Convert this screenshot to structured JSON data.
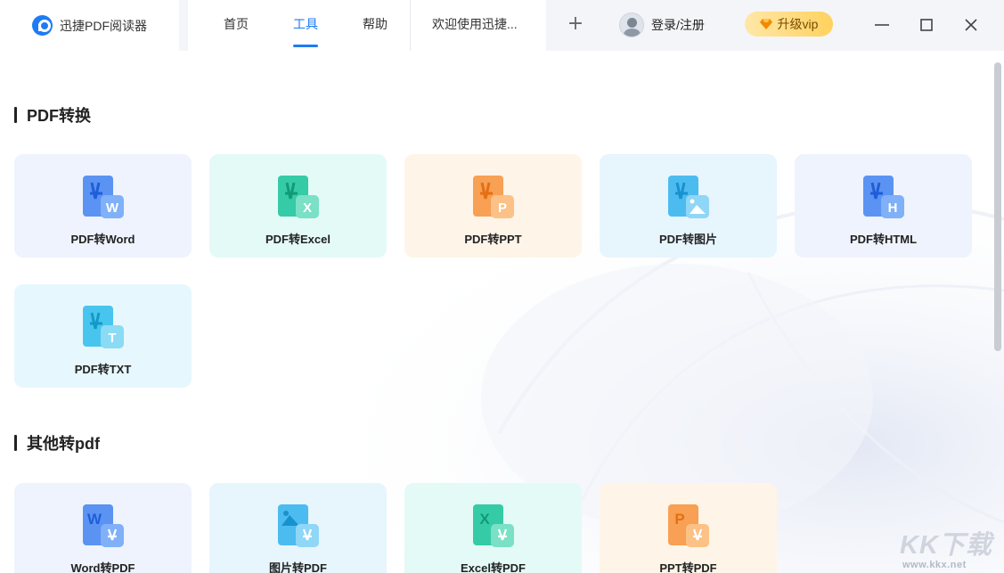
{
  "app": {
    "name": "迅捷PDF阅读器"
  },
  "tabs": [
    {
      "label": "首页",
      "active": false
    },
    {
      "label": "工具",
      "active": true
    },
    {
      "label": "帮助",
      "active": false
    },
    {
      "label": "欢迎使用迅捷...",
      "active": false
    }
  ],
  "new_tab_icon": "plus-icon",
  "user": {
    "label": "登录/注册"
  },
  "vip": {
    "label": "升级vip"
  },
  "window_controls": [
    "minimize-icon",
    "maximize-icon",
    "close-icon"
  ],
  "sections": [
    {
      "title": "PDF转换",
      "items": [
        {
          "label": "PDF转Word",
          "badge": "W",
          "color": "#4a86f0",
          "bg": "#eef3fe"
        },
        {
          "label": "PDF转Excel",
          "badge": "X",
          "color": "#2ec9a3",
          "bg": "#e4faf7"
        },
        {
          "label": "PDF转PPT",
          "badge": "P",
          "color": "#f6913b",
          "bg": "#fef4e8"
        },
        {
          "label": "PDF转图片",
          "badge": "image",
          "color": "#3fb6ee",
          "bg": "#e7f5fd"
        },
        {
          "label": "PDF转HTML",
          "badge": "H",
          "color": "#4a86f0",
          "bg": "#eef3fe"
        },
        {
          "label": "PDF转TXT",
          "badge": "T",
          "color": "#3fc0ea",
          "bg": "#e6f8fd"
        }
      ]
    },
    {
      "title": "其他转pdf",
      "items": [
        {
          "label": "Word转PDF",
          "badge": "W",
          "color": "#4a86f0",
          "bg": "#eef3fe"
        },
        {
          "label": "图片转PDF",
          "badge": "image",
          "color": "#3fb6ee",
          "bg": "#e7f5fd"
        },
        {
          "label": "Excel转PDF",
          "badge": "X",
          "color": "#2ec9a3",
          "bg": "#e4faf7"
        },
        {
          "label": "PPT转PDF",
          "badge": "P",
          "color": "#f6913b",
          "bg": "#fef4e8"
        }
      ]
    }
  ],
  "watermark": {
    "text": "KK下载",
    "url": "www.kkx.net"
  }
}
